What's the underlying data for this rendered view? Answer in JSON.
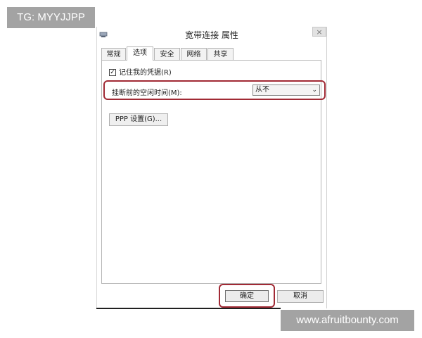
{
  "watermarks": {
    "top": "TG: MYYJJPP",
    "bottom": "www.afruitbounty.com"
  },
  "window": {
    "title": "宽带连接 属性",
    "icon": "network-connection-icon",
    "close_label": "×"
  },
  "tabs": [
    {
      "label": "常规",
      "active": false
    },
    {
      "label": "选项",
      "active": true
    },
    {
      "label": "安全",
      "active": false
    },
    {
      "label": "网络",
      "active": false
    },
    {
      "label": "共享",
      "active": false
    }
  ],
  "options": {
    "remember_credentials": {
      "label": "记住我的凭据(R)",
      "checked": true,
      "check_glyph": "✓"
    },
    "idle_time": {
      "label": "挂断前的空闲时间(M):",
      "selected": "从不",
      "arrow": "⌄"
    },
    "ppp_settings_label": "PPP 设置(G)..."
  },
  "footer": {
    "ok_label": "确定",
    "cancel_label": "取消"
  },
  "colors": {
    "highlight": "#a12a35"
  }
}
